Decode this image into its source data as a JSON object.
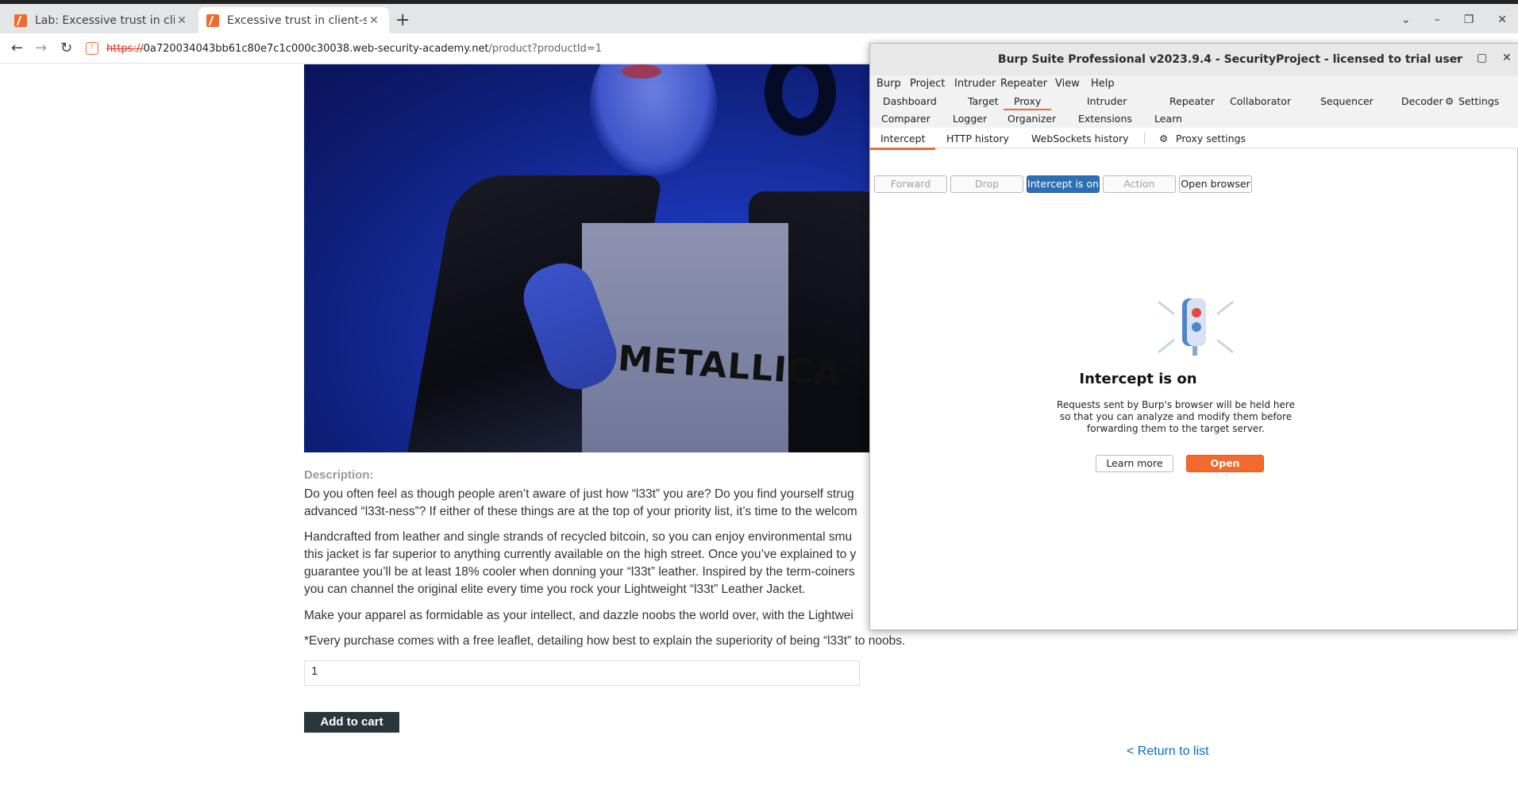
{
  "browser": {
    "tabs": [
      {
        "title": "Lab: Excessive trust in clie",
        "active": false
      },
      {
        "title": "Excessive trust in client-si",
        "active": true
      }
    ],
    "new_tab": "+",
    "url": {
      "scheme": "https://",
      "host": "0a720034043bb61c80e7c1c000c30038.web-security-academy.net",
      "path": "/product?productId=1"
    },
    "icons": [
      "back-icon",
      "forward-icon",
      "reload-icon",
      "site-icon",
      "tab-list-icon",
      "minimize-icon",
      "restore-icon",
      "close-icon"
    ]
  },
  "product": {
    "image_text": "METALLICA",
    "description_label": "Description:",
    "paragraphs": [
      "Do you often feel as though people aren’t aware of just how “l33t” you are? Do you find yourself strug",
      "advanced “l33t-ness”? If either of these things are at the top of your priority list, it’s time to the welcom",
      "Handcrafted from leather and single strands of recycled bitcoin, so you can enjoy environmental smu",
      "this jacket is far superior to anything currently available on the high street. Once you’ve explained to y",
      "guarantee you’ll be at least 18% cooler when donning your “l33t” leather. Inspired by the term-coiners",
      "you can channel the original elite every time you rock your Lightweight “l33t” Leather Jacket.",
      "Make your apparel as formidable as your intellect, and dazzle noobs the world over, with the Lightwei",
      "*Every purchase comes with a free leaflet, detailing how best to explain the superiority of being “l33t” to noobs."
    ],
    "quantity": "1",
    "add_to_cart": "Add to cart",
    "return_link": "< Return to list"
  },
  "burp": {
    "title": "Burp Suite Professional v2023.9.4 - SecurityProject - licensed to trial user",
    "window_controls": {
      "minimize": "–",
      "maximize": "▢",
      "close": "✕"
    },
    "menu": [
      "Burp",
      "Project",
      "Intruder",
      "Repeater",
      "View",
      "Help"
    ],
    "tabs_row1": [
      "Dashboard",
      "Target",
      "Proxy",
      "Intruder",
      "Repeater",
      "Collaborator",
      "Sequencer",
      "Decoder",
      "Settings"
    ],
    "tabs_row2": [
      "Comparer",
      "Logger",
      "Organizer",
      "Extensions",
      "Learn"
    ],
    "selected_tab": "Proxy",
    "subtabs": [
      "Intercept",
      "HTTP history",
      "WebSockets history",
      "Proxy settings"
    ],
    "selected_subtab": "Intercept",
    "buttons": {
      "forward": "Forward",
      "drop": "Drop",
      "intercept": "Intercept is on",
      "action": "Action",
      "open_browser": "Open browser"
    },
    "intercept_panel": {
      "heading": "Intercept is on",
      "text": "Requests sent by Burp's browser will be held here so that you can analyze and modify them before forwarding them to the target server.",
      "learn_more": "Learn more",
      "open_browser": "Open browser"
    },
    "accent_color": "#f26a2e",
    "primary_color": "#2d6fb5"
  }
}
